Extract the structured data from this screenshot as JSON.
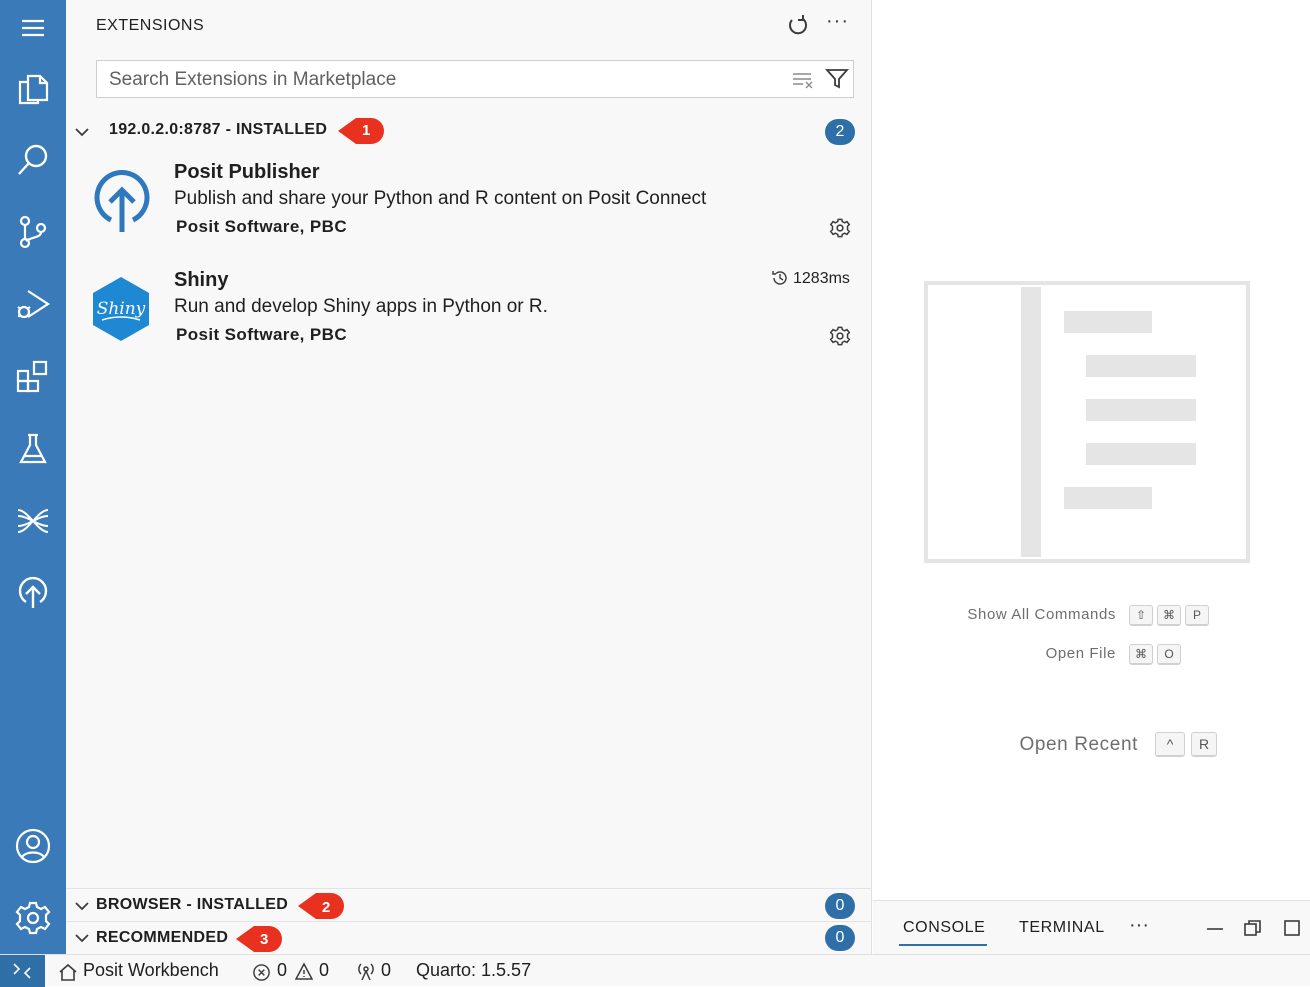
{
  "sidebar": {
    "title": "EXTENSIONS",
    "search_placeholder": "Search Extensions in Marketplace",
    "sections": [
      {
        "label": "192.0.2.0:8787 - INSTALLED",
        "count": "2",
        "callout": "1",
        "expanded": true
      },
      {
        "label": "BROWSER - INSTALLED",
        "count": "0",
        "callout": "2",
        "expanded": true
      },
      {
        "label": "RECOMMENDED",
        "count": "0",
        "callout": "3",
        "expanded": true
      }
    ],
    "extensions": [
      {
        "name": "Posit Publisher",
        "description": "Publish and share your Python and R content on Posit Connect",
        "publisher": "Posit Software, PBC",
        "icon": "posit-publisher-icon"
      },
      {
        "name": "Shiny",
        "description": "Run and develop Shiny apps in Python or R.",
        "publisher": "Posit Software, PBC",
        "icon": "shiny-logo",
        "activation_time": "1283ms"
      }
    ]
  },
  "activity_bar": [
    "menu-icon",
    "explorer-icon",
    "search-icon",
    "source-control-icon",
    "run-debug-icon",
    "extensions-icon",
    "testing-icon",
    "posit-workbench-icon",
    "posit-publisher-icon",
    "accounts-icon",
    "settings-icon"
  ],
  "welcome": {
    "commands": [
      {
        "label": "Show All Commands",
        "keys": [
          "⇧",
          "⌘",
          "P"
        ]
      },
      {
        "label": "Open File",
        "keys": [
          "⌘",
          "O"
        ]
      },
      {
        "label": "Open Recent",
        "keys": [
          "^",
          "R"
        ]
      }
    ]
  },
  "panel": {
    "tabs": [
      "CONSOLE",
      "TERMINAL"
    ],
    "active_tab": "CONSOLE"
  },
  "status": {
    "workbench": "Posit Workbench",
    "errors": "0",
    "warnings": "0",
    "ports": "0",
    "quarto": "Quarto: 1.5.57"
  },
  "colors": {
    "activity_bar": "#3a7ab8",
    "badge": "#2f6fa8",
    "callout": "#e8321f",
    "remote_indicator": "#2f6fa8"
  }
}
